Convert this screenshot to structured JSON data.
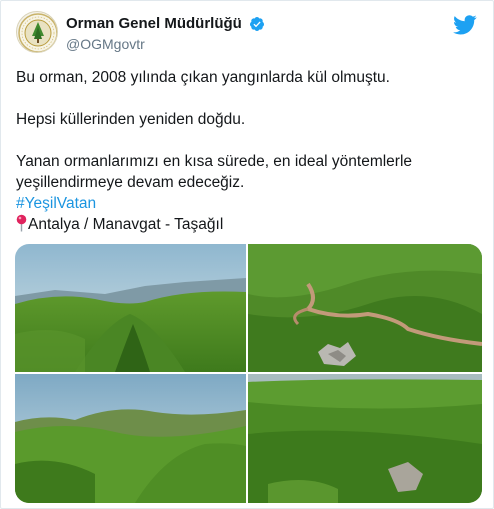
{
  "tweet": {
    "author": {
      "display_name": "Orman Genel Müdürlüğü",
      "handle": "@OGMgovtr",
      "verified": true,
      "avatar_icon": "ogm-logo-icon"
    },
    "brand_icon": "twitter-bird-icon",
    "brand_color": "#1da1f2",
    "text": {
      "line1": "Bu orman, 2008 yılında çıkan yangınlarda kül olmuştu.",
      "line2": "Hepsi küllerinden yeniden doğdu.",
      "line3": "Yanan ormanlarımızı en kısa sürede, en ideal yöntemlerle yeşillendirmeye devam edeceğiz.",
      "hashtag": "#YeşilVatan",
      "location_icon": "pin-icon",
      "location": "Antalya / Manavgat - Taşağıl"
    },
    "hashtag_color": "#1b95e0",
    "media": {
      "count": 4,
      "photos": [
        "forest-valley-photo",
        "forest-road-photo",
        "forest-hills-photo",
        "forest-dense-photo"
      ]
    }
  }
}
